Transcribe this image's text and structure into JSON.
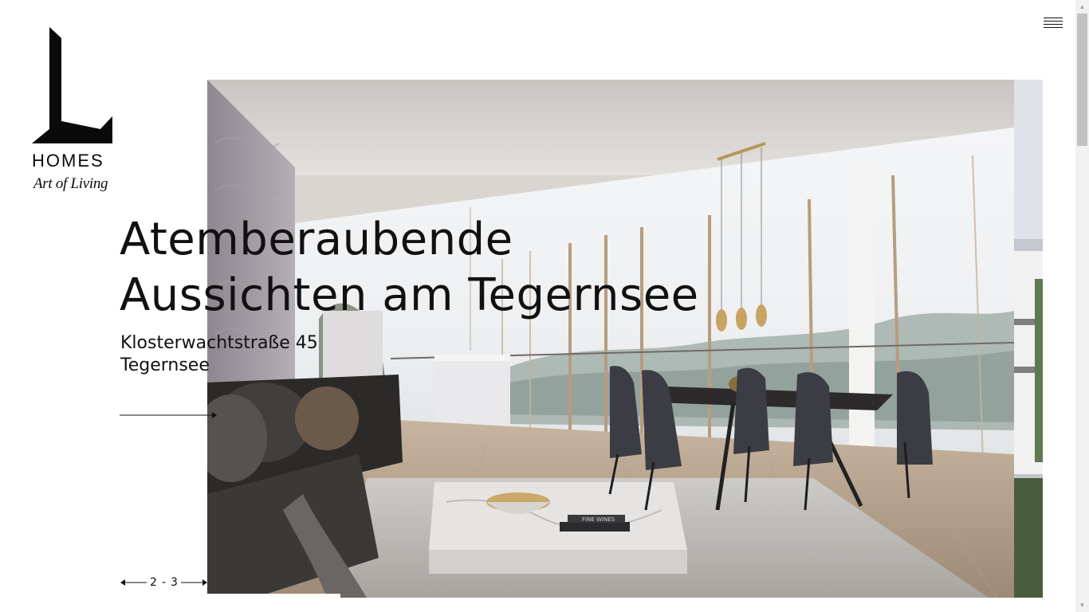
{
  "brand": {
    "name": "HOMES",
    "tagline": "Art of Living",
    "color": "#0a0a0a"
  },
  "nav": {
    "menu_icon": "hamburger-menu-icon"
  },
  "hero": {
    "headline_line1": "Atemberaubende",
    "headline_line2": "Aussichten am Tegernsee",
    "address_line1": "Klosterwachtstraße 45",
    "address_line2": "Tegernsee",
    "cta_icon": "arrow-right-icon"
  },
  "pager": {
    "current": "2",
    "separator": "-",
    "total": "3",
    "prev_icon": "arrow-left-icon",
    "next_icon": "arrow-right-icon"
  },
  "scrollbar": {
    "up_icon": "scroll-up-arrow-icon",
    "down_icon": "scroll-down-arrow-icon"
  },
  "photo": {
    "book_title": "FINE WINES"
  }
}
